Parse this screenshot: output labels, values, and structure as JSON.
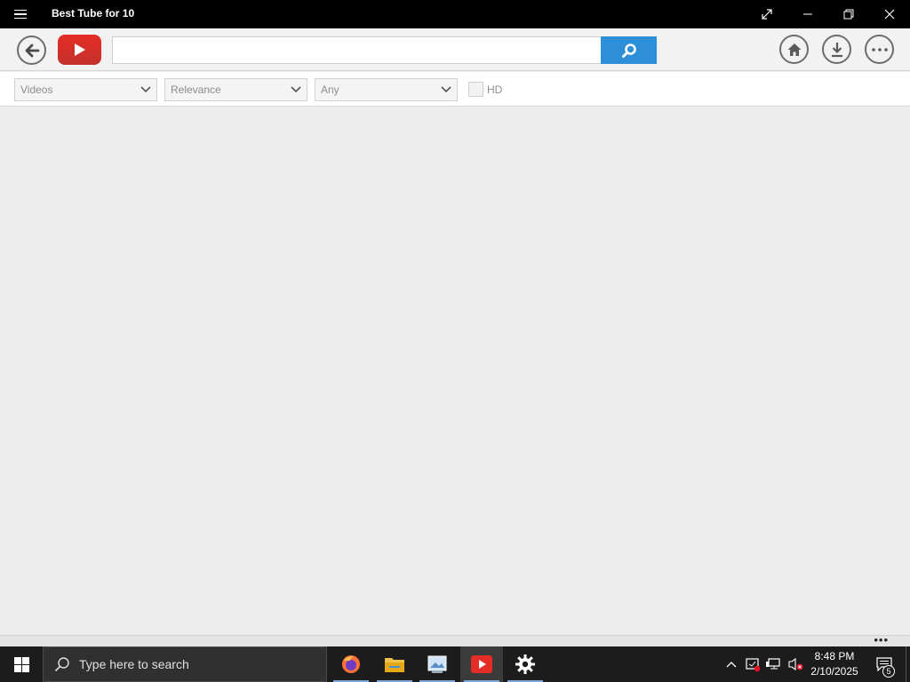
{
  "window": {
    "title": "Best Tube for 10",
    "menu_icon": "hamburger-icon",
    "controls": [
      "fullscreen-icon",
      "minimize-icon",
      "restore-icon",
      "close-icon"
    ]
  },
  "toolbar": {
    "back_icon": "back-arrow-icon",
    "logo_icon": "youtube-play-icon",
    "search": {
      "value": "",
      "placeholder": ""
    },
    "search_icon": "search-icon",
    "home_icon": "home-icon",
    "download_icon": "download-icon",
    "more_icon": "more-icon"
  },
  "filters": {
    "type": {
      "selected": "Videos"
    },
    "sort": {
      "selected": "Relevance"
    },
    "duration": {
      "selected": "Any"
    },
    "hd": {
      "label": "HD",
      "checked": false
    }
  },
  "taskbar": {
    "search_placeholder": "Type here to search",
    "apps": [
      "firefox-icon",
      "file-explorer-icon",
      "photos-icon",
      "best-tube-icon",
      "settings-icon"
    ],
    "active_app": "best-tube-icon",
    "time": "8:48 PM",
    "date": "2/10/2025",
    "notifications_count": "5"
  },
  "colors": {
    "accent": "#2d8fd7",
    "youtube_red": "#e52d27",
    "titlebar": "#000000",
    "taskbar": "#1c1c1c"
  }
}
